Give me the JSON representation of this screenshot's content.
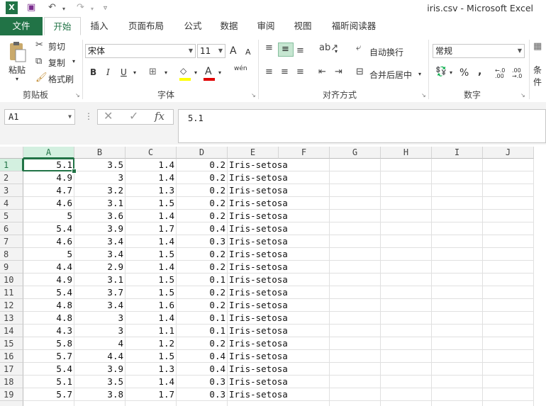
{
  "app": {
    "title": "iris.csv - Microsoft Excel",
    "brand_color": "#217346"
  },
  "quick_access": {
    "excel_icon": "excel-icon",
    "save_icon": "save-icon",
    "undo_icon": "undo-icon",
    "redo_icon": "redo-icon",
    "customize_icon": "customize-icon"
  },
  "tabs": [
    {
      "label": "文件",
      "kind": "file"
    },
    {
      "label": "开始",
      "kind": "active"
    },
    {
      "label": "插入",
      "kind": ""
    },
    {
      "label": "页面布局",
      "kind": ""
    },
    {
      "label": "公式",
      "kind": ""
    },
    {
      "label": "数据",
      "kind": ""
    },
    {
      "label": "审阅",
      "kind": ""
    },
    {
      "label": "视图",
      "kind": ""
    },
    {
      "label": "福昕阅读器",
      "kind": ""
    }
  ],
  "ribbon": {
    "clipboard": {
      "paste": "粘贴",
      "cut": "剪切",
      "copy": "复制",
      "format_painter": "格式刷",
      "label": "剪贴板"
    },
    "font": {
      "name": "宋体",
      "size": "11",
      "grow": "A",
      "shrink": "A",
      "bold": "B",
      "italic": "I",
      "underline": "U",
      "fill_glyph": "◇",
      "font_color_glyph": "A",
      "phonetic": "wén",
      "label": "字体"
    },
    "alignment": {
      "wrap": "自动换行",
      "merge": "合并后居中",
      "label": "对齐方式"
    },
    "number": {
      "format": "常规",
      "percent": "%",
      "comma": ",",
      "inc_decimal": "←.0 .00",
      "dec_decimal": ".00 →.0",
      "label": "数字"
    },
    "cutoff": "条件"
  },
  "formula_bar": {
    "name_box": "A1",
    "fx": "fx",
    "cancel": "✕",
    "enter": "✓",
    "content": "5.1"
  },
  "grid": {
    "columns": [
      "A",
      "B",
      "C",
      "D",
      "E",
      "F",
      "G",
      "H",
      "I",
      "J"
    ],
    "selected_cell": "A1",
    "rows": [
      {
        "n": "1",
        "a": "5.1",
        "b": "3.5",
        "c": "1.4",
        "d": "0.2",
        "e": "Iris-setosa"
      },
      {
        "n": "2",
        "a": "4.9",
        "b": "3",
        "c": "1.4",
        "d": "0.2",
        "e": "Iris-setosa"
      },
      {
        "n": "3",
        "a": "4.7",
        "b": "3.2",
        "c": "1.3",
        "d": "0.2",
        "e": "Iris-setosa"
      },
      {
        "n": "4",
        "a": "4.6",
        "b": "3.1",
        "c": "1.5",
        "d": "0.2",
        "e": "Iris-setosa"
      },
      {
        "n": "5",
        "a": "5",
        "b": "3.6",
        "c": "1.4",
        "d": "0.2",
        "e": "Iris-setosa"
      },
      {
        "n": "6",
        "a": "5.4",
        "b": "3.9",
        "c": "1.7",
        "d": "0.4",
        "e": "Iris-setosa"
      },
      {
        "n": "7",
        "a": "4.6",
        "b": "3.4",
        "c": "1.4",
        "d": "0.3",
        "e": "Iris-setosa"
      },
      {
        "n": "8",
        "a": "5",
        "b": "3.4",
        "c": "1.5",
        "d": "0.2",
        "e": "Iris-setosa"
      },
      {
        "n": "9",
        "a": "4.4",
        "b": "2.9",
        "c": "1.4",
        "d": "0.2",
        "e": "Iris-setosa"
      },
      {
        "n": "10",
        "a": "4.9",
        "b": "3.1",
        "c": "1.5",
        "d": "0.1",
        "e": "Iris-setosa"
      },
      {
        "n": "11",
        "a": "5.4",
        "b": "3.7",
        "c": "1.5",
        "d": "0.2",
        "e": "Iris-setosa"
      },
      {
        "n": "12",
        "a": "4.8",
        "b": "3.4",
        "c": "1.6",
        "d": "0.2",
        "e": "Iris-setosa"
      },
      {
        "n": "13",
        "a": "4.8",
        "b": "3",
        "c": "1.4",
        "d": "0.1",
        "e": "Iris-setosa"
      },
      {
        "n": "14",
        "a": "4.3",
        "b": "3",
        "c": "1.1",
        "d": "0.1",
        "e": "Iris-setosa"
      },
      {
        "n": "15",
        "a": "5.8",
        "b": "4",
        "c": "1.2",
        "d": "0.2",
        "e": "Iris-setosa"
      },
      {
        "n": "16",
        "a": "5.7",
        "b": "4.4",
        "c": "1.5",
        "d": "0.4",
        "e": "Iris-setosa"
      },
      {
        "n": "17",
        "a": "5.4",
        "b": "3.9",
        "c": "1.3",
        "d": "0.4",
        "e": "Iris-setosa"
      },
      {
        "n": "18",
        "a": "5.1",
        "b": "3.5",
        "c": "1.4",
        "d": "0.3",
        "e": "Iris-setosa"
      },
      {
        "n": "19",
        "a": "5.7",
        "b": "3.8",
        "c": "1.7",
        "d": "0.3",
        "e": "Iris-setosa"
      }
    ]
  }
}
